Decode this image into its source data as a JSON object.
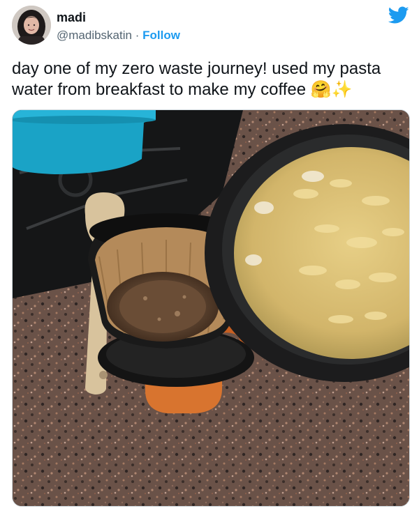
{
  "author": {
    "name": "madi",
    "handle": "@madibskatin",
    "separator": "·",
    "follow_label": "Follow"
  },
  "tweet": {
    "text": "day one of my zero waste journey! used my pasta water from breakfast to make my coffee 🤗✨"
  },
  "icons": {
    "brand": "twitter-bird-icon"
  },
  "colors": {
    "accent": "#1d9bf0",
    "text": "#0f1419",
    "secondary": "#536471"
  }
}
